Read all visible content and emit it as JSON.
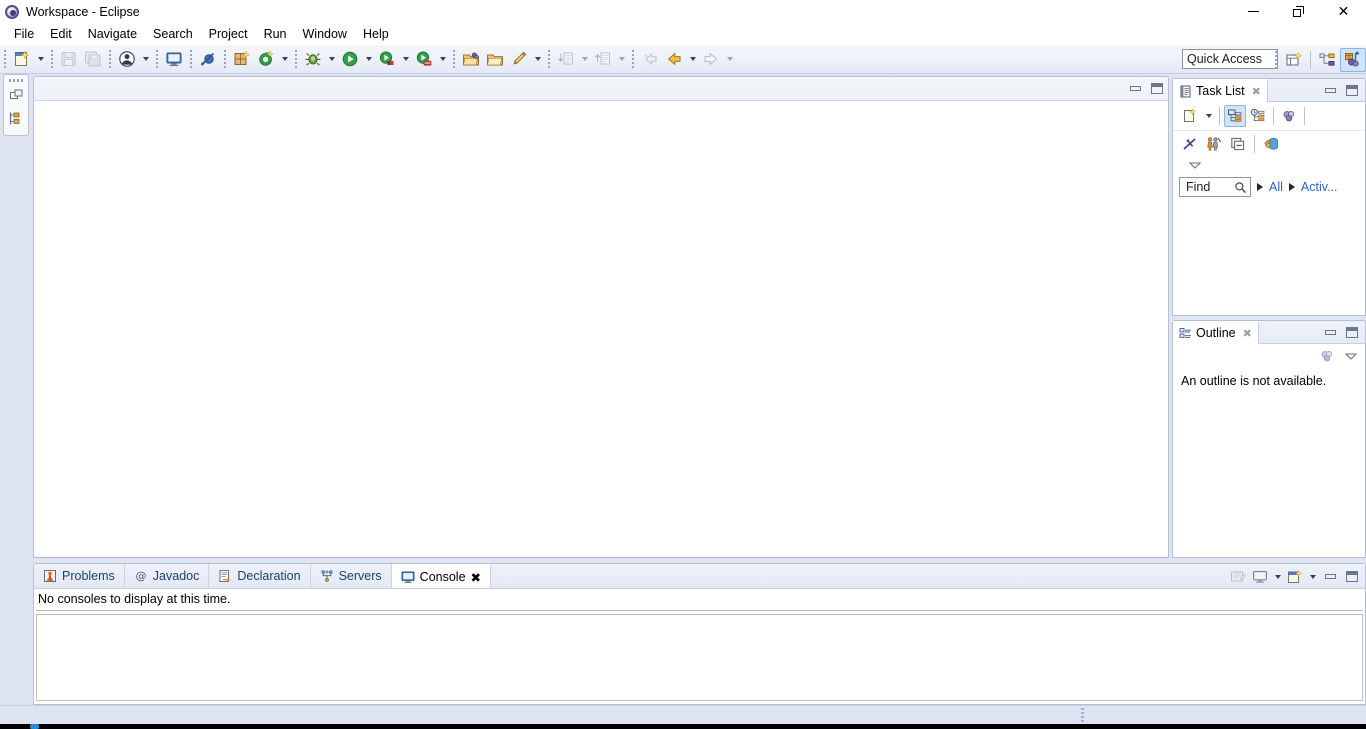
{
  "window": {
    "title": "Workspace - Eclipse",
    "app_icon": "eclipse-icon",
    "controls": {
      "minimize": "minimize-window",
      "restore": "restore-window",
      "close": "close-window"
    }
  },
  "menubar": {
    "items": [
      {
        "label": "File"
      },
      {
        "label": "Edit"
      },
      {
        "label": "Navigate"
      },
      {
        "label": "Search"
      },
      {
        "label": "Project"
      },
      {
        "label": "Run"
      },
      {
        "label": "Window"
      },
      {
        "label": "Help"
      }
    ]
  },
  "toolbar": {
    "groups": [
      {
        "items": [
          {
            "icon": "new-wizard-icon",
            "dropdown": true
          },
          {
            "icon": "save-icon",
            "disabled": true
          },
          {
            "icon": "save-all-icon",
            "disabled": true
          }
        ]
      },
      {
        "items": [
          {
            "icon": "user-profile-icon",
            "dropdown": true
          }
        ]
      },
      {
        "items": [
          {
            "icon": "open-console-icon"
          }
        ]
      },
      {
        "items": [
          {
            "icon": "skip-breakpoints-icon"
          }
        ]
      },
      {
        "items": [
          {
            "icon": "new-package-icon"
          },
          {
            "icon": "refresh-green-icon",
            "dropdown": true
          }
        ]
      },
      {
        "items": [
          {
            "icon": "debug-bug-icon",
            "dropdown": true
          },
          {
            "icon": "run-play-icon",
            "dropdown": true
          },
          {
            "icon": "run-external-tools-icon",
            "dropdown": true
          },
          {
            "icon": "run-server-icon",
            "dropdown": true
          }
        ]
      },
      {
        "items": [
          {
            "icon": "new-java-project-icon"
          },
          {
            "icon": "open-type-icon"
          },
          {
            "icon": "new-annotation-icon",
            "dropdown": true
          }
        ]
      },
      {
        "items": [
          {
            "icon": "step-into-icon",
            "disabled": true,
            "dropdown": true
          },
          {
            "icon": "step-return-icon",
            "disabled": true,
            "dropdown": true
          }
        ]
      },
      {
        "items": [
          {
            "icon": "back-history-icon",
            "disabled": true
          },
          {
            "icon": "back-arrow-icon",
            "dropdown": true
          },
          {
            "icon": "forward-arrow-icon",
            "disabled": true,
            "dropdown": true
          }
        ]
      }
    ],
    "quick_access": {
      "placeholder": "Quick Access",
      "value": "Quick Access"
    },
    "perspective": {
      "open_perspective": "open-perspective-icon",
      "buttons": [
        {
          "icon": "java-ee-perspective-icon",
          "active": false
        },
        {
          "icon": "java-perspective-icon",
          "active": true
        }
      ]
    }
  },
  "left_minimized_bar": {
    "restore_icon": "restore-view-icon",
    "items": [
      {
        "icon": "package-explorer-icon"
      }
    ]
  },
  "editor": {
    "controls": {
      "minimize": "minimize-editor-area",
      "maximize": "maximize-editor-area"
    },
    "content": ""
  },
  "task_list": {
    "tab": {
      "label": "Task List",
      "icon": "task-list-icon",
      "close": "close-view"
    },
    "controls": {
      "minimize": "minimize-view",
      "maximize": "maximize-view"
    },
    "toolbar_row1": [
      {
        "icon": "new-task-icon",
        "dropdown": true
      },
      {
        "icon": "categorized-presentation-icon",
        "active": true
      },
      {
        "icon": "scheduled-presentation-icon",
        "active": false
      },
      {
        "icon": "synchronize-changed-icon",
        "active": false
      }
    ],
    "toolbar_row2": [
      {
        "icon": "focus-on-workweek-icon"
      },
      {
        "icon": "show-all-tasks-icon"
      },
      {
        "icon": "collapse-all-icon"
      },
      {
        "icon": "add-repository-icon"
      }
    ],
    "overflow": "view-menu-chevron",
    "find": {
      "placeholder": "Find",
      "value": "Find",
      "search_icon": "search-icon"
    },
    "filters": [
      {
        "label": "All"
      },
      {
        "label": "Activ..."
      }
    ]
  },
  "outline": {
    "tab": {
      "label": "Outline",
      "icon": "outline-icon",
      "close": "close-view"
    },
    "controls": {
      "minimize": "minimize-view",
      "maximize": "maximize-view"
    },
    "toolbar": [
      {
        "icon": "link-with-editor-icon"
      },
      {
        "icon": "view-menu-chevron"
      }
    ],
    "message": "An outline is not available."
  },
  "bottom_panel": {
    "tabs": [
      {
        "label": "Problems",
        "icon": "problems-icon",
        "active": false
      },
      {
        "label": "Javadoc",
        "icon": "javadoc-icon",
        "active": false
      },
      {
        "label": "Declaration",
        "icon": "declaration-icon",
        "active": false
      },
      {
        "label": "Servers",
        "icon": "servers-icon",
        "active": false
      },
      {
        "label": "Console",
        "icon": "console-icon",
        "active": true,
        "close": "close-view"
      }
    ],
    "toolbar": [
      {
        "icon": "clear-console-icon",
        "disabled": true
      },
      {
        "icon": "display-selected-console-icon",
        "dropdown": true
      },
      {
        "icon": "open-console-icon",
        "dropdown": true
      }
    ],
    "controls": {
      "minimize": "minimize-view",
      "maximize": "maximize-view"
    },
    "message": "No consoles to display at this time."
  },
  "statusbar": {
    "text": "",
    "resize_grip": "resize-grip"
  },
  "colors": {
    "chrome": "#dfe4f3",
    "toolbar_top": "#f4f6fb",
    "panel_bg": "#ffffff",
    "tab_text": "#1c3f6e",
    "link": "#2d63c8",
    "active_tab_highlight": "#cfe4fa"
  }
}
